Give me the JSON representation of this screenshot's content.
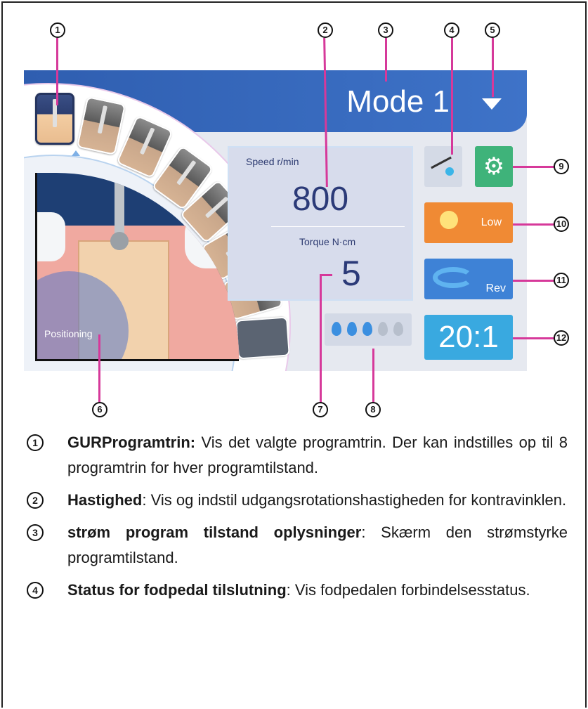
{
  "screen": {
    "mode_title": "Mode 1",
    "speed": {
      "label": "Speed  r/min",
      "value": "800"
    },
    "torque": {
      "label": "Torque  N·cm",
      "value": "5"
    },
    "positioning_label": "Positioning",
    "light": {
      "label": "Low"
    },
    "direction": {
      "label": "Rev"
    },
    "ratio": "20:1",
    "water_level": {
      "filled": 3,
      "total": 5
    },
    "program_steps": {
      "count": 8,
      "selected": 1
    },
    "colors": {
      "header": "#3466b8",
      "gear_button": "#3fb37a",
      "light_button": "#f08a34",
      "rev_button": "#3e82d6",
      "ratio_button": "#39a9e0",
      "callout_line": "#d6399a"
    }
  },
  "callouts": [
    "1",
    "2",
    "3",
    "4",
    "5",
    "6",
    "7",
    "8",
    "9",
    "10",
    "11",
    "12"
  ],
  "legend": [
    {
      "num": "①",
      "term": "GURProgramtrin:",
      "text": " Vis det valgte programtrin. Der kan indstilles op til 8 programtrin for hver programtilstand."
    },
    {
      "num": "②",
      "term": "Hastighed",
      "text": ": Vis og indstil udgangsrotationshastigheden for kontravinklen."
    },
    {
      "num": "③",
      "term": "strøm    program tilstand   oplysninger",
      "text": ": Skærm    den strømstyrke programtilstand."
    },
    {
      "num": "④",
      "term": "Status      for      fodpedal      tilslutning",
      "text": ":     Vis      fodpedalen forbindelsesstatus."
    }
  ]
}
